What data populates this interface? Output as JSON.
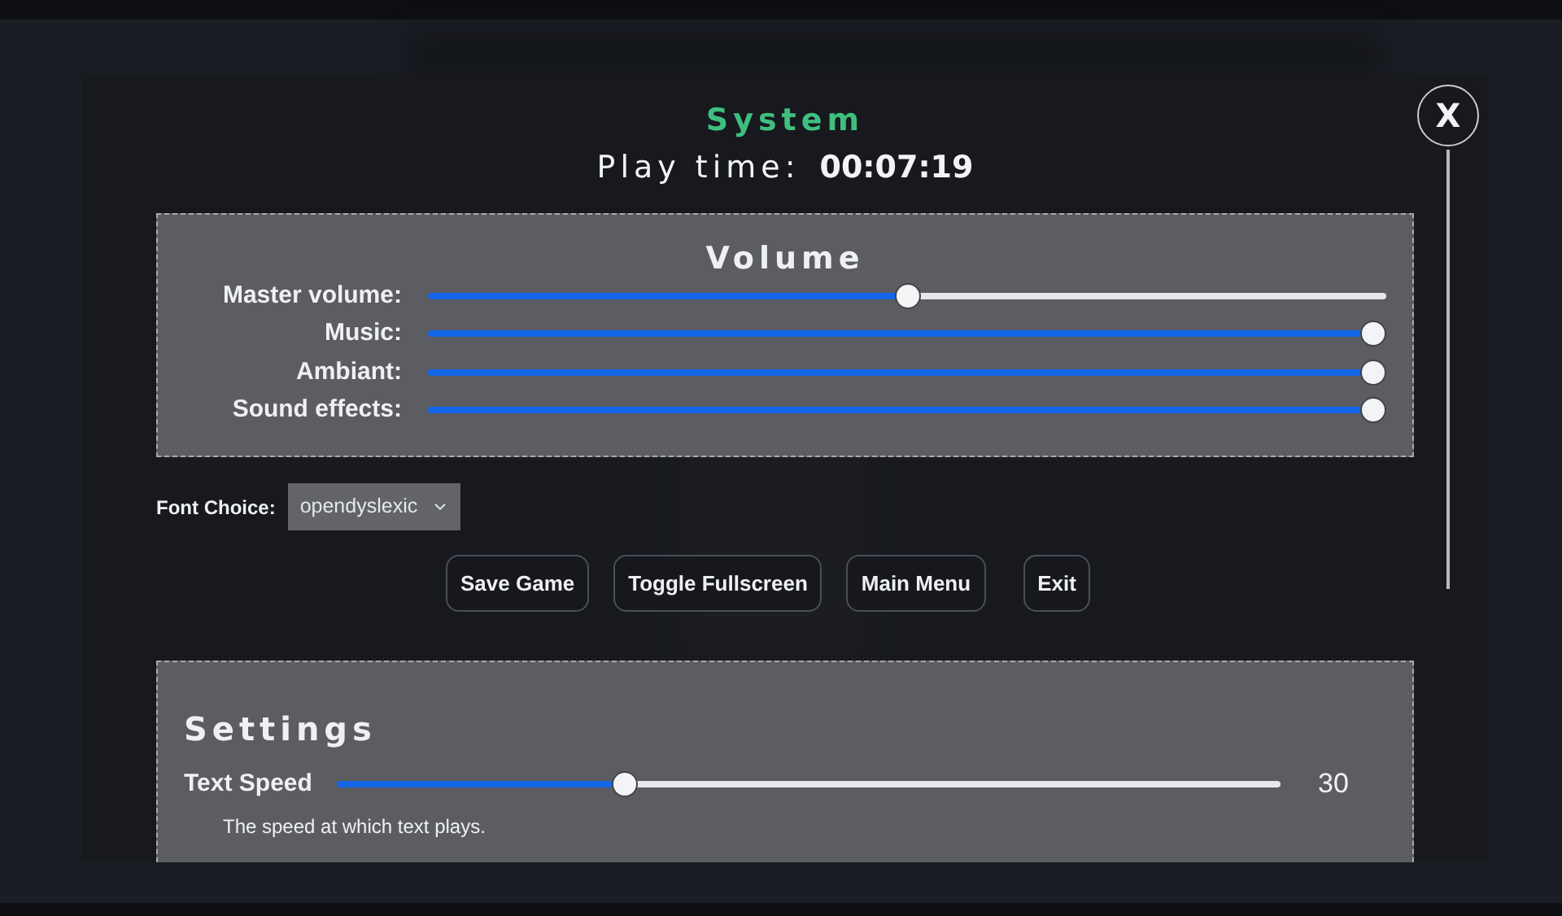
{
  "dialog": {
    "title": "System",
    "play_time_label": "Play time:",
    "play_time": "00:07:19",
    "close": "X"
  },
  "volume": {
    "title": "Volume",
    "sliders": [
      {
        "label": "Master volume:",
        "level": 0.5
      },
      {
        "label": "Music:",
        "level": 1
      },
      {
        "label": "Ambiant:",
        "level": 1
      },
      {
        "label": "Sound effects:",
        "level": 1
      }
    ]
  },
  "font_choice": {
    "label": "Font Choice:",
    "value": "opendyslexic"
  },
  "buttons": [
    "Save Game",
    "Toggle Fullscreen",
    "Main Menu",
    "Exit"
  ],
  "settings": {
    "title": "Settings",
    "items": [
      {
        "label": "Text Speed",
        "level": 0.3,
        "reading": "30",
        "description": "The speed at which text plays."
      }
    ]
  }
}
